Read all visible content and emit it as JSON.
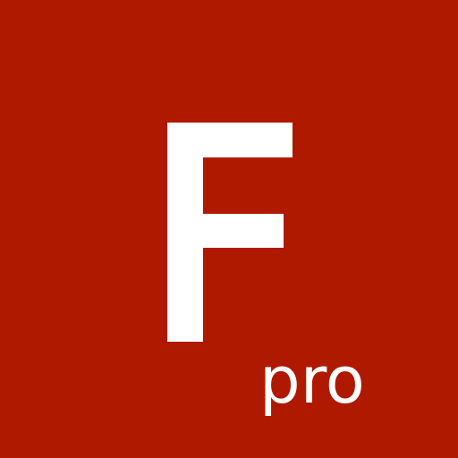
{
  "icon": {
    "letter": "F",
    "label": "pro",
    "background_color": "#ae1900",
    "foreground_color": "#ffffff"
  }
}
